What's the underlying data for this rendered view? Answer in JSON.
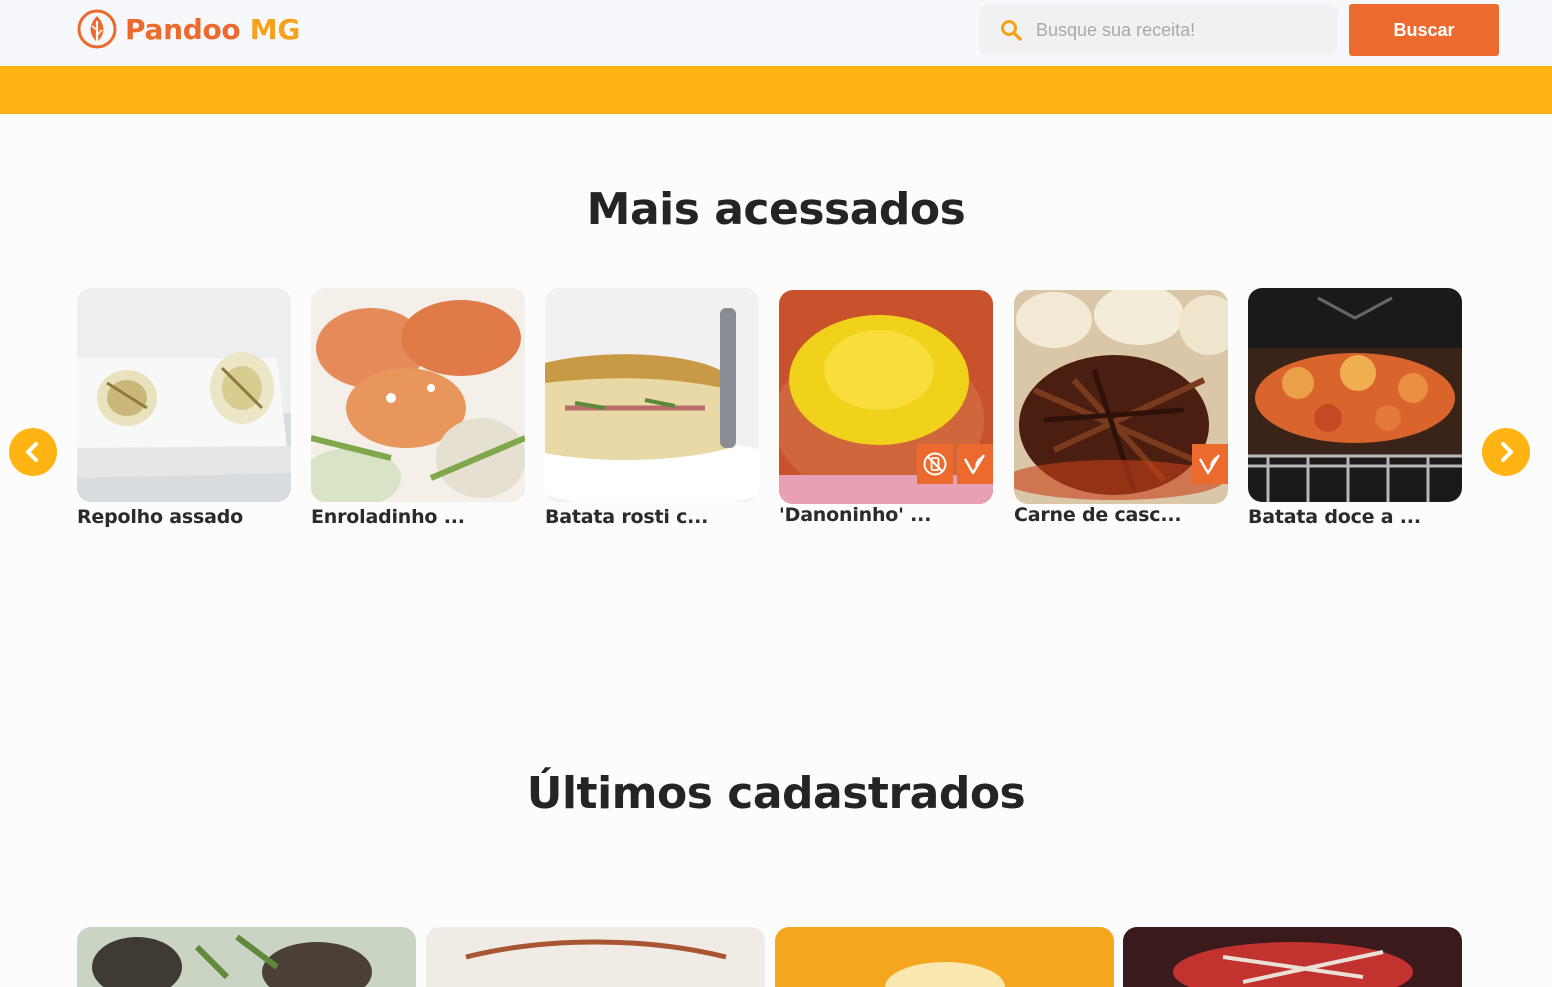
{
  "header": {
    "logo_main": "Pandoo",
    "logo_suffix": " MG",
    "search_placeholder": "Busque sua receita!",
    "search_button": "Buscar",
    "brand_orange": "#ec6a2e",
    "brand_yellow": "#ffb414"
  },
  "sections": {
    "most_accessed": "Mais acessados",
    "latest": "Últimos cadastrados"
  },
  "carousel": {
    "prev_icon": "chevron-left-icon",
    "next_icon": "chevron-right-icon",
    "cards": [
      {
        "title": "Repolho assado",
        "badges": []
      },
      {
        "title": "Enroladinho ...",
        "badges": []
      },
      {
        "title": "Batata rosti c...",
        "badges": []
      },
      {
        "title": "'Danoninho' ...",
        "badges": [
          "no-lactose-icon",
          "vegan-icon"
        ]
      },
      {
        "title": "Carne de casc...",
        "badges": [
          "vegan-icon"
        ]
      },
      {
        "title": "Batata doce a ...",
        "badges": []
      }
    ]
  }
}
